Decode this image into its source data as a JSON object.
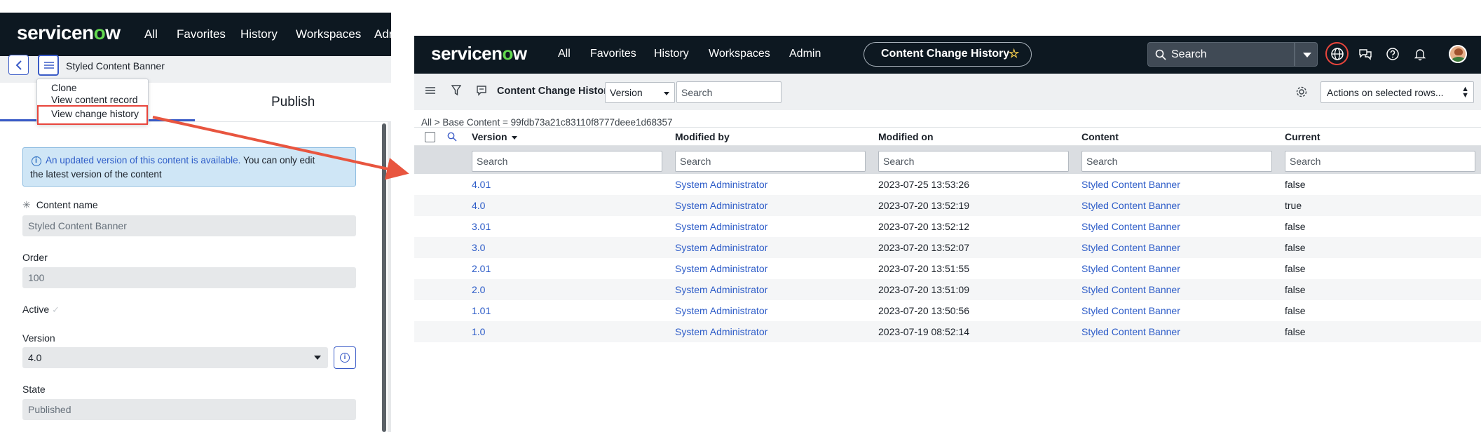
{
  "left": {
    "nav": {
      "logo": "servicenow",
      "items": [
        "All",
        "Favorites",
        "History",
        "Workspaces",
        "Adr"
      ]
    },
    "record_title": "Styled Content Banner",
    "menu": [
      "Clone",
      "View content record",
      "View change history"
    ],
    "tab_publish": "Publish",
    "info": {
      "link_text": "An updated version of this content is available.",
      "text_after": " You can only edit",
      "line2": "the latest version of the content"
    },
    "fields": {
      "content_name_label": "Content name",
      "content_name_value": "Styled Content Banner",
      "order_label": "Order",
      "order_value": "100",
      "active_label": "Active",
      "version_label": "Version",
      "version_value": "4.0",
      "state_label": "State",
      "state_value": "Published"
    }
  },
  "right": {
    "nav": {
      "logo": "servicenow",
      "items": [
        "All",
        "Favorites",
        "History",
        "Workspaces",
        "Admin"
      ],
      "pill": "Content Change History",
      "search_placeholder": "Search"
    },
    "toolbar": {
      "title": "Content Change History",
      "field_select": "Version",
      "search_placeholder": "Search",
      "actions": "Actions on selected rows..."
    },
    "breadcrumb": "All > Base Content = 99fdb73a21c83110f8777deee1d68357",
    "columns": [
      "Version",
      "Modified by",
      "Modified on",
      "Content",
      "Current"
    ],
    "column_search_placeholder": "Search",
    "rows": [
      {
        "version": "4.01",
        "modified_by": "System Administrator",
        "modified_on": "2023-07-25 13:53:26",
        "content": "Styled Content Banner",
        "current": "false"
      },
      {
        "version": "4.0",
        "modified_by": "System Administrator",
        "modified_on": "2023-07-20 13:52:19",
        "content": "Styled Content Banner",
        "current": "true"
      },
      {
        "version": "3.01",
        "modified_by": "System Administrator",
        "modified_on": "2023-07-20 13:52:12",
        "content": "Styled Content Banner",
        "current": "false"
      },
      {
        "version": "3.0",
        "modified_by": "System Administrator",
        "modified_on": "2023-07-20 13:52:07",
        "content": "Styled Content Banner",
        "current": "false"
      },
      {
        "version": "2.01",
        "modified_by": "System Administrator",
        "modified_on": "2023-07-20 13:51:55",
        "content": "Styled Content Banner",
        "current": "false"
      },
      {
        "version": "2.0",
        "modified_by": "System Administrator",
        "modified_on": "2023-07-20 13:51:09",
        "content": "Styled Content Banner",
        "current": "false"
      },
      {
        "version": "1.01",
        "modified_by": "System Administrator",
        "modified_on": "2023-07-20 13:50:56",
        "content": "Styled Content Banner",
        "current": "false"
      },
      {
        "version": "1.0",
        "modified_by": "System Administrator",
        "modified_on": "2023-07-19 08:52:14",
        "content": "Styled Content Banner",
        "current": "false"
      }
    ]
  },
  "colors": {
    "nav_bg": "#0d1821",
    "link": "#2d5cc8",
    "highlight_red": "#e8453c",
    "logo_green": "#62d84e",
    "info_bg": "#cfe6f6"
  }
}
